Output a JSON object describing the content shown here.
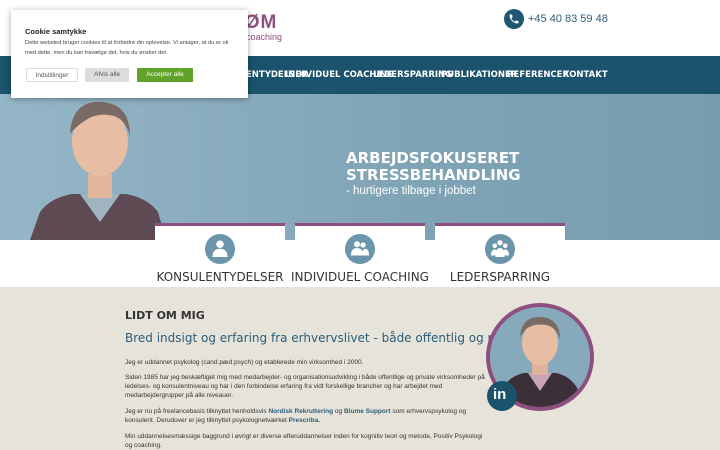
{
  "header": {
    "logo_text": "RØM",
    "logo_sub": "coaching",
    "phone": "+45 40 83 59 48"
  },
  "nav": {
    "items": [
      "KONSULENTYDELSER",
      "INDIVIDUEL COACHING",
      "LEDERSPARRING",
      "PUBLIKATIONER",
      "REFERENCER",
      "KONTAKT"
    ]
  },
  "hero": {
    "title_line1": "ARBEJDSFOKUSERET",
    "title_line2": "STRESSBEHANDLING",
    "subtitle": "- hurtigere tilbage i jobbet"
  },
  "services": [
    {
      "label": "KONSULENTYDELSER",
      "icon": "person-icon"
    },
    {
      "label": "INDIVIDUEL COACHING",
      "icon": "group-icon"
    },
    {
      "label": "LEDERSPARRING",
      "icon": "team-icon"
    }
  ],
  "about": {
    "heading": "LIDT OM MIG",
    "lead": "Bred indsigt og erfaring fra erhvervslivet - både offentlig og privat",
    "p1": "Jeg er uddannet psykolog (cand.pæd.psych) og etablerede min virksomhed i 2000.",
    "p2": "Siden 1985 har jeg beskæftiget mig med medarbejder- og organisationsudvikling i både offentlige og private virksomheder på ledelses- og konsulentniveau og har i den forbindelse erfaring fra vidt forskellige brancher og har arbejdet med medarbejdergrupper på alle niveauer.",
    "p3_start": "Jeg er nu på freelancebasis tilknyttet henholdsvis",
    "p3_b1": "Nordisk Rekruttering",
    "p3_mid": "og",
    "p3_b2": "Blume Support",
    "p3_end": "som erhvervspsykolog og konsulent. Derudover er jeg tilknyttet psykolognetværket",
    "p3_b3": "Prescriba.",
    "p4": "Min uddannelsesmæssige baggrund i øvrigt er diverse efteruddannelser inden for kognitiv teori og metode, Positiv Psykologi og coaching.",
    "linkedin": "in"
  },
  "cookie": {
    "title": "Cookie samtykke",
    "text": "Dette websted bruger cookies til at forbedre din oplevelse. Vi antager, at du er ok med dette, men du kan fravælge det, hvis du ønsker det.",
    "settings": "Indstillinger",
    "reject": "Afvis alle",
    "accept": "Accepter alle"
  },
  "colors": {
    "nav_bg": "#1b536d",
    "accent": "#8e4e7e",
    "accept_green": "#61a229",
    "about_bg": "#e6e4da"
  }
}
